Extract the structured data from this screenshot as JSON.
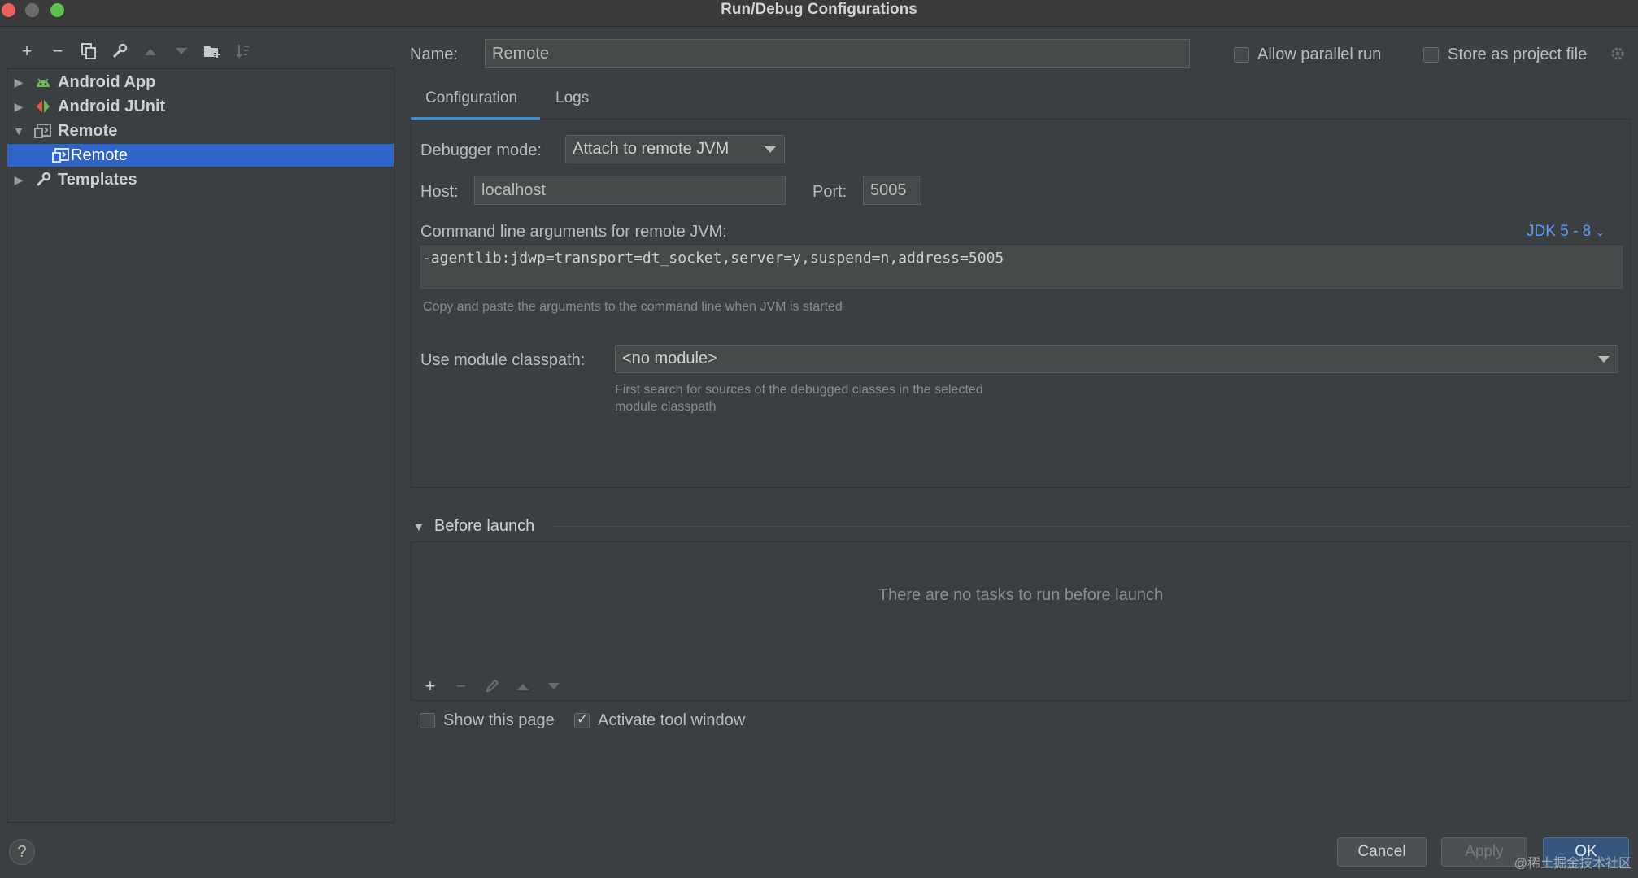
{
  "window": {
    "title": "Run/Debug Configurations"
  },
  "tree": {
    "items": [
      {
        "label": "Android App",
        "icon": "android-icon",
        "expanded": false
      },
      {
        "label": "Android JUnit",
        "icon": "junit-icon",
        "expanded": false
      },
      {
        "label": "Remote",
        "icon": "remote-icon",
        "expanded": true
      },
      {
        "label": "Remote",
        "icon": "remote-icon",
        "selected": true
      },
      {
        "label": "Templates",
        "icon": "wrench-icon",
        "expanded": false
      }
    ]
  },
  "header": {
    "name_label": "Name:",
    "name_value": "Remote",
    "allow_parallel_label": "Allow parallel run",
    "allow_parallel_checked": false,
    "store_project_label": "Store as project file",
    "store_project_checked": false
  },
  "tabs": [
    {
      "label": "Configuration",
      "active": true
    },
    {
      "label": "Logs",
      "active": false
    }
  ],
  "config": {
    "debugger_mode_label": "Debugger mode:",
    "debugger_mode_value": "Attach to remote JVM",
    "host_label": "Host:",
    "host_value": "localhost",
    "port_label": "Port:",
    "port_value": "5005",
    "cmd_label": "Command line arguments for remote JVM:",
    "jdk_link": "JDK 5 - 8",
    "cmd_value": "-agentlib:jdwp=transport=dt_socket,server=y,suspend=n,address=5005",
    "cmd_hint": "Copy and paste the arguments to the command line when JVM is started",
    "module_label": "Use module classpath:",
    "module_value": "<no module>",
    "module_hint_1": "First search for sources of the debugged classes in the selected",
    "module_hint_2": "module classpath"
  },
  "before_launch": {
    "title": "Before launch",
    "empty_text": "There are no tasks to run before launch",
    "show_page_label": "Show this page",
    "show_page_checked": false,
    "activate_tool_label": "Activate tool window",
    "activate_tool_checked": true
  },
  "buttons": {
    "cancel": "Cancel",
    "apply": "Apply",
    "ok": "OK",
    "help": "?"
  },
  "watermark": "@稀土掘金技术社区",
  "colors": {
    "selection": "#2f65ca",
    "link": "#589df6",
    "background": "#3c3f41"
  }
}
